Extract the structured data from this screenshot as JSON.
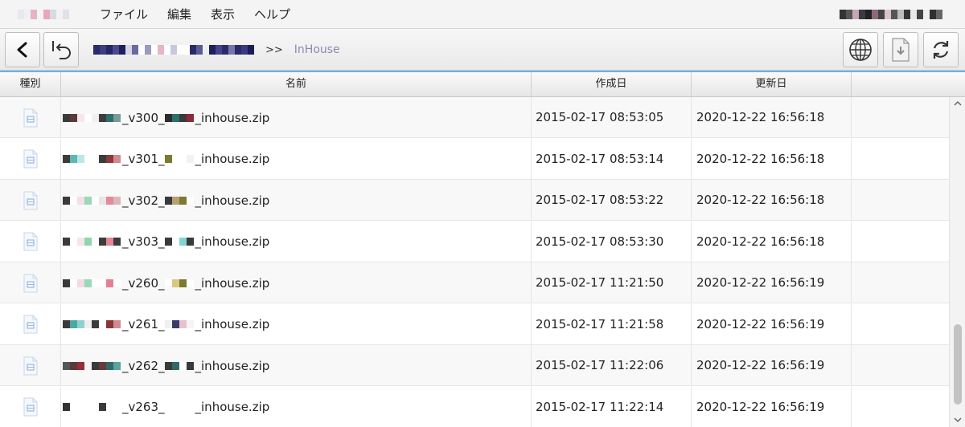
{
  "menubar": {
    "items": [
      "ファイル",
      "編集",
      "表示",
      "ヘルプ"
    ]
  },
  "breadcrumb": {
    "separator": ">>",
    "current": "InHouse"
  },
  "table": {
    "columns": [
      "種別",
      "名前",
      "作成日",
      "更新日"
    ],
    "rows": [
      {
        "name_suffix": "_v300_",
        "name_tail": "_inhouse.zip",
        "created": "2015-02-17 08:53:05",
        "updated": "2020-12-22 16:56:18"
      },
      {
        "name_suffix": "_v301_",
        "name_tail": "_inhouse.zip",
        "created": "2015-02-17 08:53:14",
        "updated": "2020-12-22 16:56:18"
      },
      {
        "name_suffix": "_v302_",
        "name_tail": "_inhouse.zip",
        "created": "2015-02-17 08:53:22",
        "updated": "2020-12-22 16:56:18"
      },
      {
        "name_suffix": "_v303_",
        "name_tail": "_inhouse.zip",
        "created": "2015-02-17 08:53:30",
        "updated": "2020-12-22 16:56:18"
      },
      {
        "name_suffix": "_v260_",
        "name_tail": "_inhouse.zip",
        "created": "2015-02-17 11:21:50",
        "updated": "2020-12-22 16:56:19"
      },
      {
        "name_suffix": "_v261_",
        "name_tail": "_inhouse.zip",
        "created": "2015-02-17 11:21:58",
        "updated": "2020-12-22 16:56:19"
      },
      {
        "name_suffix": "_v262_",
        "name_tail": "_inhouse.zip",
        "created": "2015-02-17 11:22:06",
        "updated": "2020-12-22 16:56:19"
      },
      {
        "name_suffix": "_v263_",
        "name_tail": "_inhouse.zip",
        "created": "2015-02-17 11:22:14",
        "updated": "2020-12-22 16:56:19"
      }
    ]
  },
  "icons": {
    "back": "chevron-left-icon",
    "undo": "undo-arrow-icon",
    "globe": "globe-icon",
    "download": "download-file-icon",
    "refresh": "refresh-icon",
    "file": "zip-file-icon"
  },
  "colors": {
    "accent": "#6fb0e2",
    "breadcrumb_current": "#8a8ab0"
  }
}
